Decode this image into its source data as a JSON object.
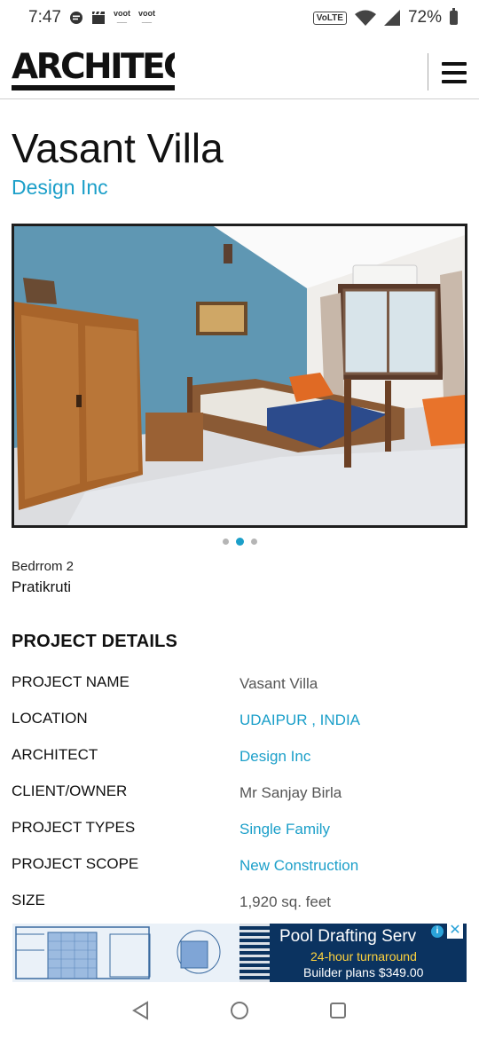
{
  "status_bar": {
    "time": "7:47",
    "app_icons": [
      "voot",
      "voot"
    ],
    "network_label": "VoLTE",
    "battery": "72%"
  },
  "header": {
    "logo": "ARCHITECT",
    "menu_icon": "hamburger-icon"
  },
  "project": {
    "title": "Vasant Villa",
    "firm": "Design Inc"
  },
  "gallery": {
    "image": "bedroom with wooden wardrobe, blue accent wall and orange armchairs",
    "active_index": 2,
    "count": 3,
    "caption": "Bedrrom 2",
    "credit": "Pratikruti"
  },
  "details": {
    "heading": "PROJECT DETAILS",
    "rows": [
      {
        "label": "PROJECT NAME",
        "value": "Vasant Villa",
        "link": false
      },
      {
        "label": "LOCATION",
        "value": "UDAIPUR , INDIA",
        "link": true
      },
      {
        "label": "ARCHITECT",
        "value": "Design Inc",
        "link": true
      },
      {
        "label": "CLIENT/OWNER",
        "value": "Mr Sanjay Birla",
        "link": false
      },
      {
        "label": "PROJECT TYPES",
        "value": "Single Family",
        "link": true
      },
      {
        "label": "PROJECT SCOPE",
        "value": "New Construction",
        "link": true
      },
      {
        "label": "SIZE",
        "value": "1,920 sq. feet",
        "link": false
      }
    ]
  },
  "ad": {
    "headline": "Pool Drafting Serv",
    "sub": "24-hour turnaround",
    "price": "Builder plans $349.00",
    "info": "i",
    "close": "✕"
  },
  "colors": {
    "accent": "#1b9fc9",
    "ad_bg": "#0b3360",
    "ad_yellow": "#ffd33d"
  }
}
